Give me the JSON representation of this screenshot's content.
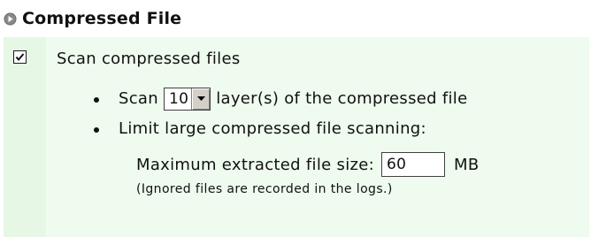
{
  "section": {
    "title": "Compressed File",
    "icon": "circle-arrow-right-icon"
  },
  "scan_option": {
    "label": "Scan compressed files",
    "checked": true
  },
  "layers": {
    "prefix": "Scan",
    "value": "10",
    "suffix": "layer(s) of the compressed file"
  },
  "limit": {
    "label": "Limit large compressed file scanning:"
  },
  "max_size": {
    "label": "Maximum extracted file size:",
    "value": "60",
    "unit": "MB"
  },
  "note": "(Ignored files are recorded in the logs.)",
  "colors": {
    "panel": "#eefbee",
    "checkbox_column": "#e6f7e6",
    "icon": "#888888"
  }
}
